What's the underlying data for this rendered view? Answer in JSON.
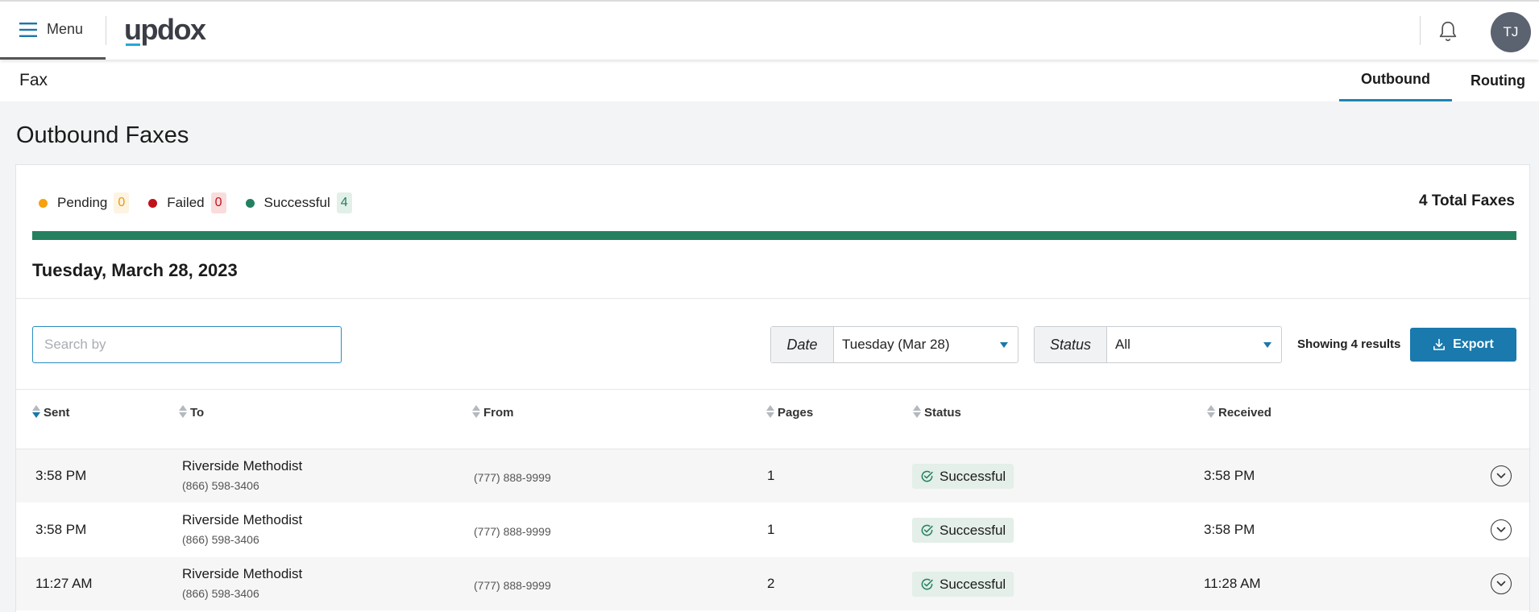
{
  "topbar": {
    "menu_label": "Menu",
    "logo_text": "updox",
    "avatar_initials": "TJ"
  },
  "subheader": {
    "title": "Fax",
    "tabs": [
      {
        "label": "Outbound",
        "active": true
      },
      {
        "label": "Routing",
        "active": false
      }
    ]
  },
  "page_title": "Outbound Faxes",
  "summary": {
    "pending_label": "Pending",
    "pending_count": "0",
    "failed_label": "Failed",
    "failed_count": "0",
    "successful_label": "Successful",
    "successful_count": "4",
    "total_label": "4 Total Faxes",
    "success_fraction": 1.0,
    "colors": {
      "pending": "#f4a20d",
      "failed": "#c0121b",
      "successful": "#258060"
    }
  },
  "date_heading": "Tuesday, March 28, 2023",
  "filters": {
    "search_placeholder": "Search by",
    "search_value": "",
    "date_label": "Date",
    "date_value": "Tuesday (Mar 28)",
    "status_label": "Status",
    "status_value": "All",
    "showing": "Showing 4 results",
    "export_label": "Export"
  },
  "table": {
    "columns": [
      "Sent",
      "To",
      "From",
      "Pages",
      "Status",
      "Received"
    ],
    "rows": [
      {
        "sent": "3:58 PM",
        "to_name": "Riverside Methodist",
        "to_number": "(866) 598-3406",
        "from": "(777) 888-9999",
        "pages": "1",
        "status": "Successful",
        "received": "3:58 PM"
      },
      {
        "sent": "3:58 PM",
        "to_name": "Riverside Methodist",
        "to_number": "(866) 598-3406",
        "from": "(777) 888-9999",
        "pages": "1",
        "status": "Successful",
        "received": "3:58 PM"
      },
      {
        "sent": "11:27 AM",
        "to_name": "Riverside Methodist",
        "to_number": "(866) 598-3406",
        "from": "(777) 888-9999",
        "pages": "2",
        "status": "Successful",
        "received": "11:28 AM"
      }
    ]
  }
}
